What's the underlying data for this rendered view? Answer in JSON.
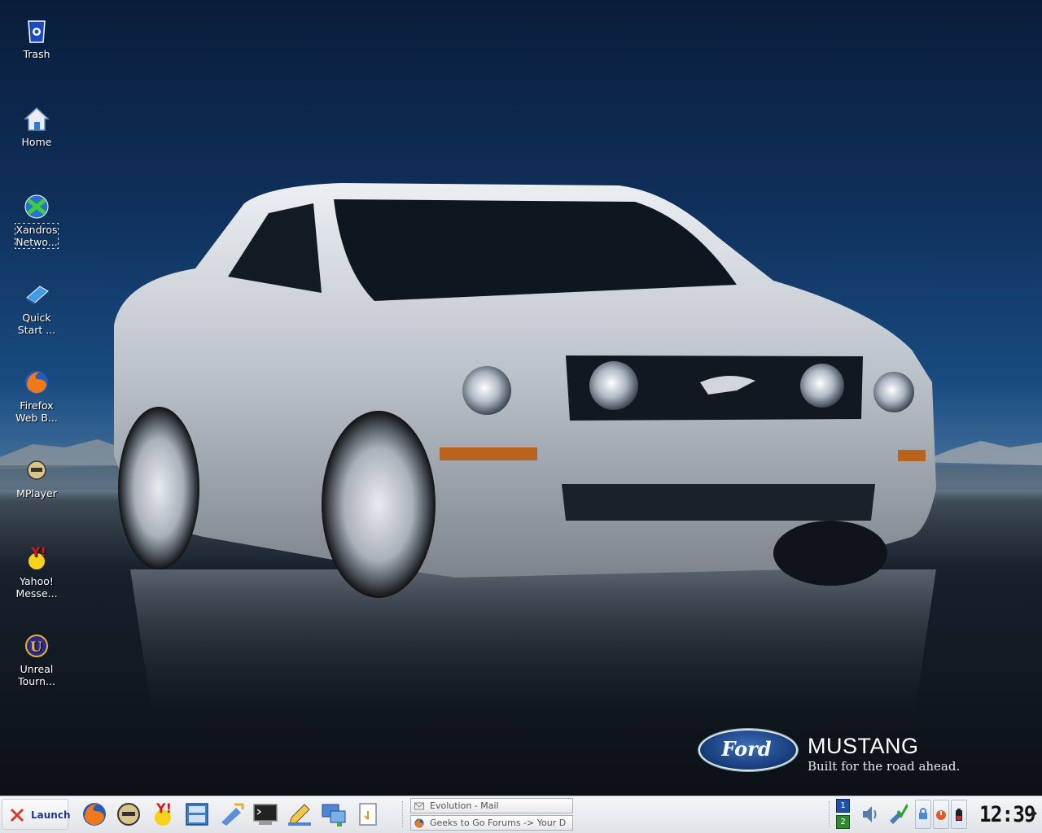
{
  "desktop": {
    "icons": [
      {
        "label": "Trash",
        "icon": "trash-icon"
      },
      {
        "label": "Home",
        "icon": "home-icon"
      },
      {
        "label": "Xandros Netwo...",
        "icon": "xandros-network-icon"
      },
      {
        "label": "Quick Start ...",
        "icon": "quick-start-book-icon"
      },
      {
        "label": "Firefox Web B...",
        "icon": "firefox-icon"
      },
      {
        "label": "MPlayer",
        "icon": "mplayer-icon"
      },
      {
        "label": "Yahoo! Messe...",
        "icon": "yahoo-messenger-icon"
      },
      {
        "label": "Unreal Tourn...",
        "icon": "unreal-tournament-icon"
      }
    ],
    "wallpaper": {
      "brand": "Ford",
      "model": "MUSTANG",
      "slogan": "Built for the road ahead."
    }
  },
  "taskbar": {
    "launch_label": "Launch",
    "quick_launch": [
      "firefox-icon",
      "mplayer-icon",
      "yahoo-messenger-icon",
      "file-manager-icon",
      "control-center-icon",
      "terminal-icon",
      "text-editor-icon",
      "network-icon",
      "notepad-icon"
    ],
    "tasks": [
      {
        "label": "Evolution - Mail",
        "icon": "mail-icon"
      },
      {
        "label": "Geeks to Go Forums -> Your D",
        "icon": "firefox-icon"
      }
    ],
    "pager": [
      "1",
      "2"
    ],
    "tray": [
      "volume-icon",
      "network-update-icon",
      "lock-icon",
      "power-icon",
      "battery-icon"
    ],
    "clock": "12:39"
  },
  "colors": {
    "pager_active": "#1f4fa8",
    "pager_inactive": "#2e8a2e",
    "launch_text": "#1d3c8a"
  }
}
